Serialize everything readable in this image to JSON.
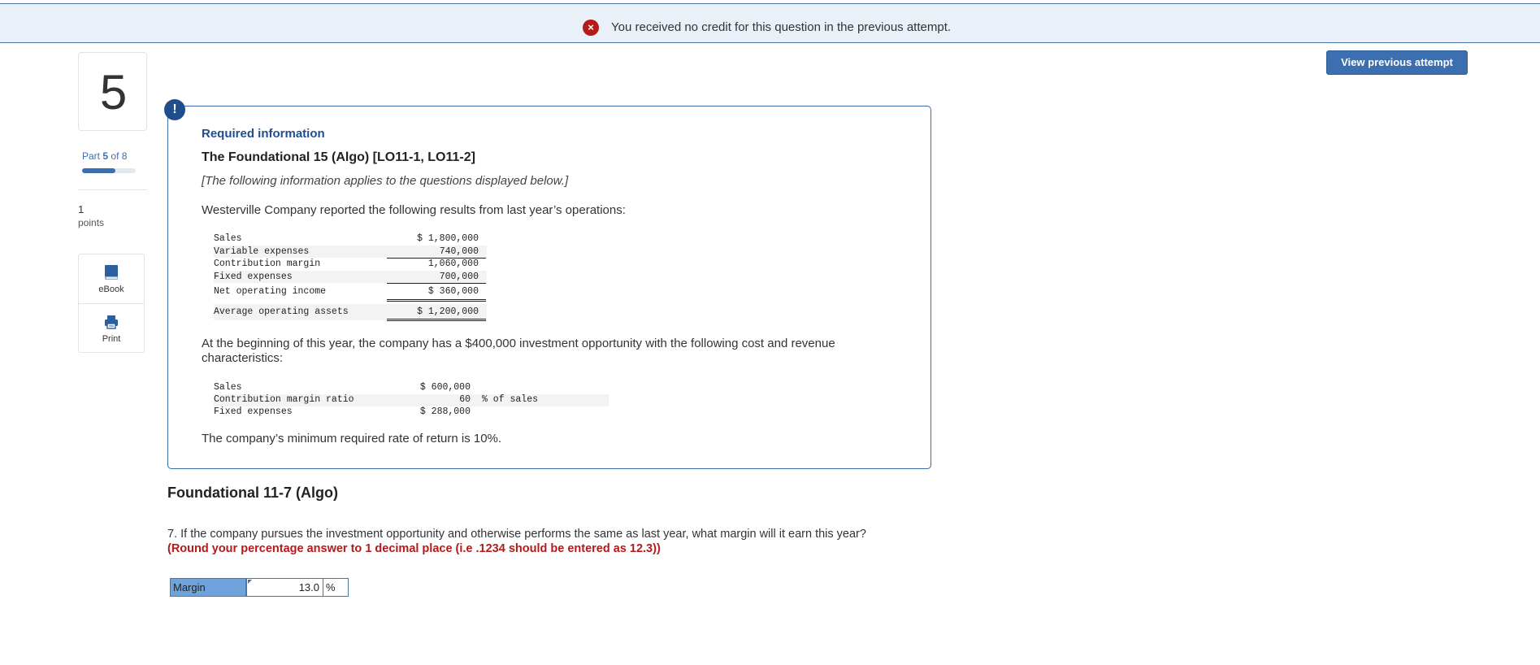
{
  "banner": {
    "icon": "error-x-icon",
    "message": "You received no credit for this question in the previous attempt."
  },
  "view_previous_button": "View previous attempt",
  "question_number": "5",
  "part": {
    "prefix": "Part",
    "current": "5",
    "of_text": "of 8",
    "progress_fraction": 0.625
  },
  "points": {
    "value": "1",
    "label": "points"
  },
  "tools": [
    {
      "icon": "book-icon",
      "label": "eBook"
    },
    {
      "icon": "printer-icon",
      "label": "Print"
    }
  ],
  "info": {
    "alert_icon_text": "!",
    "required": "Required information",
    "title": "The Foundational 15 (Algo) [LO11-1, LO11-2]",
    "applies": "[The following information applies to the questions displayed below.]",
    "intro": "Westerville Company reported the following results from last year’s operations:",
    "results": [
      {
        "label": "Sales",
        "value": "$ 1,800,000"
      },
      {
        "label": "Variable expenses",
        "value": "740,000"
      },
      {
        "label": "Contribution margin",
        "value": "1,060,000"
      },
      {
        "label": "Fixed expenses",
        "value": "700,000"
      },
      {
        "label": "Net operating income",
        "value": "$ 360,000"
      },
      {
        "label": "Average operating assets",
        "value": "$ 1,200,000"
      }
    ],
    "opportunity": "At the beginning of this year, the company has a $400,000 investment opportunity with the following cost and revenue characteristics:",
    "investment": [
      {
        "label": "Sales",
        "value": "$ 600,000",
        "unit": ""
      },
      {
        "label": "Contribution margin ratio",
        "value": "60",
        "unit": "% of sales"
      },
      {
        "label": "Fixed expenses",
        "value": "$ 288,000",
        "unit": ""
      }
    ],
    "min_rate": "The company’s minimum required rate of return is 10%."
  },
  "section_title": "Foundational 11-7 (Algo)",
  "question": "7. If the company pursues the investment opportunity and otherwise performs the same as last year, what margin will it earn this year?",
  "instruction": "(Round your percentage answer to 1 decimal place (i.e .1234 should be entered as 12.3))",
  "answer": {
    "label": "Margin",
    "value": "13.0",
    "unit": "%"
  }
}
